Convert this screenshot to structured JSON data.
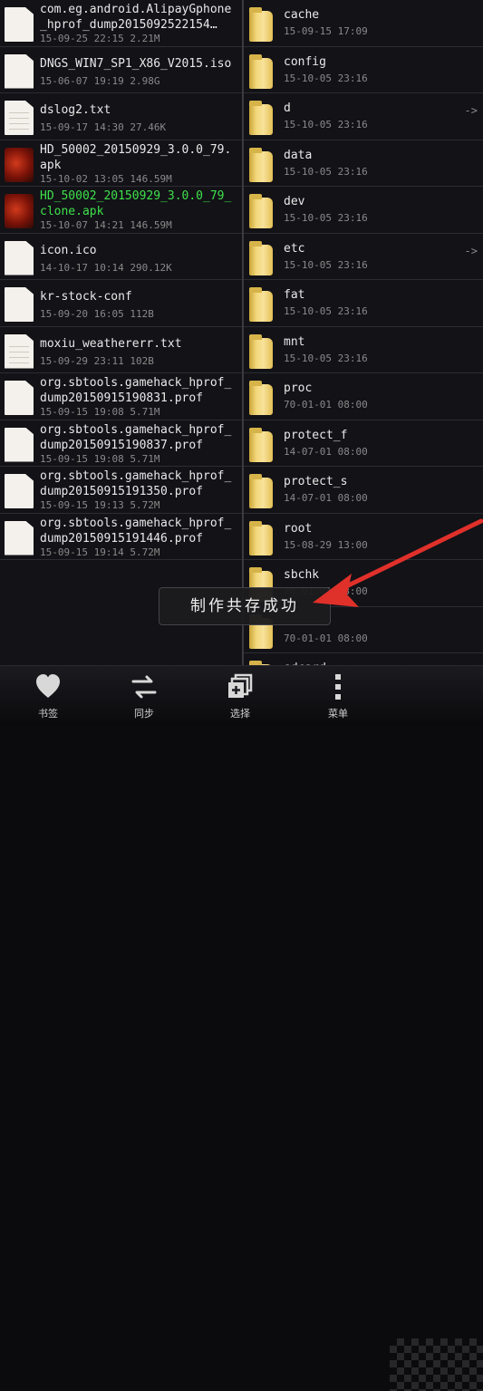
{
  "left_files": [
    {
      "name": "com.eg.android.AlipayGphone_hprof_dump2015092522154…",
      "meta": "15-09-25 22:15 2.21M",
      "icon": "doc",
      "highlight": false
    },
    {
      "name": "DNGS_WIN7_SP1_X86_V2015.iso",
      "meta": "15-06-07 19:19 2.98G",
      "icon": "doc",
      "highlight": false
    },
    {
      "name": "dslog2.txt",
      "meta": "15-09-17 14:30 27.46K",
      "icon": "doc-lined",
      "highlight": false
    },
    {
      "name": "HD_50002_20150929_3.0.0_79.apk",
      "meta": "15-10-02 13:05 146.59M",
      "icon": "apk",
      "highlight": false
    },
    {
      "name": "HD_50002_20150929_3.0.0_79_clone.apk",
      "meta": "15-10-07 14:21 146.59M",
      "icon": "apk",
      "highlight": true
    },
    {
      "name": "icon.ico",
      "meta": "14-10-17 10:14 290.12K",
      "icon": "doc",
      "highlight": false
    },
    {
      "name": "kr-stock-conf",
      "meta": "15-09-20 16:05 112B",
      "icon": "doc",
      "highlight": false
    },
    {
      "name": "moxiu_weathererr.txt",
      "meta": "15-09-29 23:11 102B",
      "icon": "doc-lined",
      "highlight": false
    },
    {
      "name": "org.sbtools.gamehack_hprof_dump20150915190831.prof",
      "meta": "15-09-15 19:08 5.71M",
      "icon": "doc",
      "highlight": false
    },
    {
      "name": "org.sbtools.gamehack_hprof_dump20150915190837.prof",
      "meta": "15-09-15 19:08 5.71M",
      "icon": "doc",
      "highlight": false
    },
    {
      "name": "org.sbtools.gamehack_hprof_dump20150915191350.prof",
      "meta": "15-09-15 19:13 5.72M",
      "icon": "doc",
      "highlight": false
    },
    {
      "name": "org.sbtools.gamehack_hprof_dump20150915191446.prof",
      "meta": "15-09-15 19:14 5.72M",
      "icon": "doc",
      "highlight": false
    }
  ],
  "right_folders": [
    {
      "name": "cache",
      "meta": "15-09-15 17:09",
      "link": ""
    },
    {
      "name": "config",
      "meta": "15-10-05 23:16",
      "link": ""
    },
    {
      "name": "d",
      "meta": "15-10-05 23:16",
      "link": "->"
    },
    {
      "name": "data",
      "meta": "15-10-05 23:16",
      "link": ""
    },
    {
      "name": "dev",
      "meta": "15-10-05 23:16",
      "link": ""
    },
    {
      "name": "etc",
      "meta": "15-10-05 23:16",
      "link": "->"
    },
    {
      "name": "fat",
      "meta": "15-10-05 23:16",
      "link": ""
    },
    {
      "name": "mnt",
      "meta": "15-10-05 23:16",
      "link": ""
    },
    {
      "name": "proc",
      "meta": "70-01-01 08:00",
      "link": ""
    },
    {
      "name": "protect_f",
      "meta": "14-07-01 08:00",
      "link": ""
    },
    {
      "name": "protect_s",
      "meta": "14-07-01 08:00",
      "link": ""
    },
    {
      "name": "root",
      "meta": "15-08-29 13:00",
      "link": ""
    },
    {
      "name": "sbchk",
      "meta": "70-01-01 08:00",
      "link": ""
    },
    {
      "name": "",
      "meta": "70-01-01 08:00",
      "link": ""
    },
    {
      "name": "sdcard",
      "meta": "",
      "link": ""
    }
  ],
  "toast": {
    "text": "制作共存成功"
  },
  "bottom_nav": [
    {
      "label": "书签",
      "icon": "heart-icon"
    },
    {
      "label": "同步",
      "icon": "sync-arrows-icon"
    },
    {
      "label": "选择",
      "icon": "select-multiple-icon"
    },
    {
      "label": "菜单",
      "icon": "menu-dots-icon"
    }
  ],
  "colors": {
    "background": "#121217",
    "highlight_text": "#3fe04a",
    "arrow": "#e0302a",
    "folder": "#f3d77a"
  }
}
